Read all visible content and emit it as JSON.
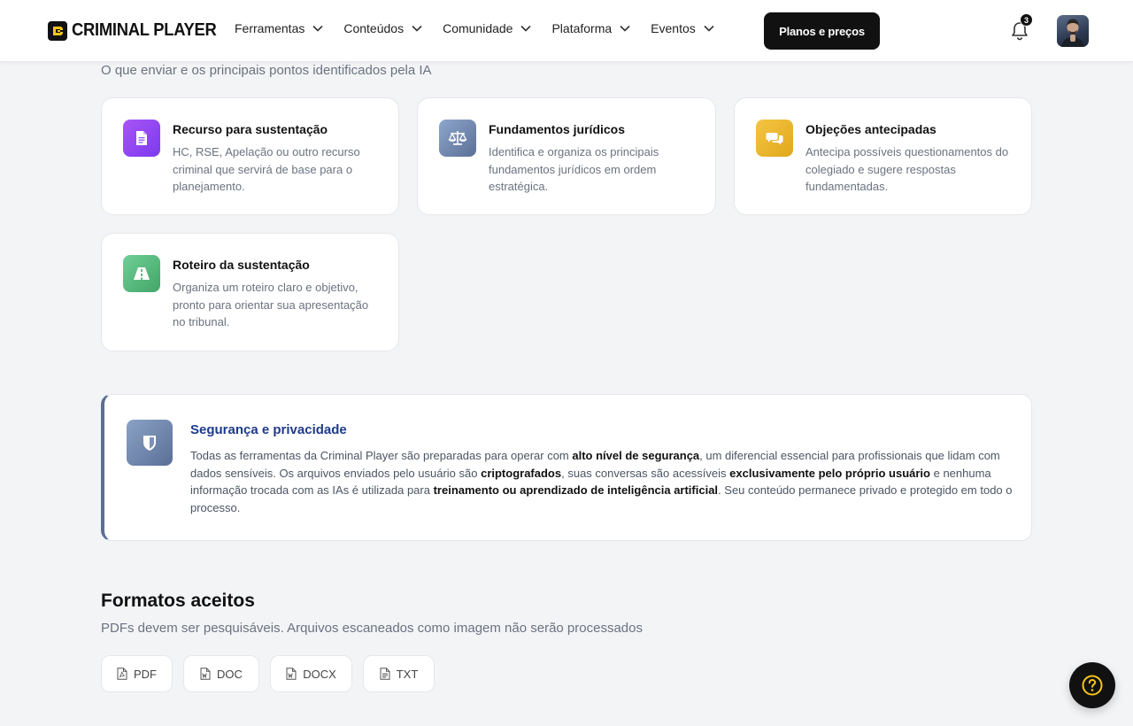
{
  "brand": {
    "name": "CRIMINAL PLAYER"
  },
  "nav": {
    "items": [
      {
        "label": "Ferramentas"
      },
      {
        "label": "Conteúdos"
      },
      {
        "label": "Comunidade"
      },
      {
        "label": "Plataforma"
      },
      {
        "label": "Eventos"
      }
    ],
    "cta_label": "Planos e preços",
    "notification_count": "3"
  },
  "intro": {
    "subtitle": "O que enviar e os principais pontos identificados pela IA"
  },
  "cards": [
    {
      "title": "Recurso para sustentação",
      "desc": "HC, RSE, Apelação ou outro recurso criminal que servirá de base para o planejamento.",
      "icon": "document-icon",
      "color": "#7c3aed"
    },
    {
      "title": "Fundamentos jurídicos",
      "desc": "Identifica e organiza os principais fundamentos jurídicos em ordem estratégica.",
      "icon": "scale-icon",
      "color": "#5b6f96"
    },
    {
      "title": "Objeções antecipadas",
      "desc": "Antecipa possíveis questionamentos do colegiado e sugere respostas fundamentadas.",
      "icon": "chat-bubbles-icon",
      "color": "#e0a81c"
    },
    {
      "title": "Roteiro da sustentação",
      "desc": "Organiza um roteiro claro e objetivo, pronto para orientar sua apresentação no tribunal.",
      "icon": "road-icon",
      "color": "#4caf73"
    }
  ],
  "security": {
    "title": "Segurança e privacidade",
    "p1": "Todas as ferramentas da Criminal Player são preparadas para operar com ",
    "b1": "alto nível de segurança",
    "p2": ", um diferencial essencial para profissionais que lidam com dados sensíveis. Os arquivos enviados pelo usuário são ",
    "b2": "criptografados",
    "p3": ", suas conversas são acessíveis ",
    "b3": "exclusivamente pelo próprio usuário",
    "p4": " e nenhuma informação trocada com as IAs é utilizada para ",
    "b4": "treinamento ou aprendizado de inteligência artificial",
    "p5": ". Seu conteúdo permanece privado e protegido em todo o processo."
  },
  "formats": {
    "title": "Formatos aceitos",
    "subtitle": "PDFs devem ser pesquisáveis. Arquivos escaneados como imagem não serão processados",
    "items": [
      {
        "label": "PDF",
        "icon": "pdf-file-icon"
      },
      {
        "label": "DOC",
        "icon": "word-file-icon"
      },
      {
        "label": "DOCX",
        "icon": "word-file-icon"
      },
      {
        "label": "TXT",
        "icon": "text-file-icon"
      }
    ]
  }
}
